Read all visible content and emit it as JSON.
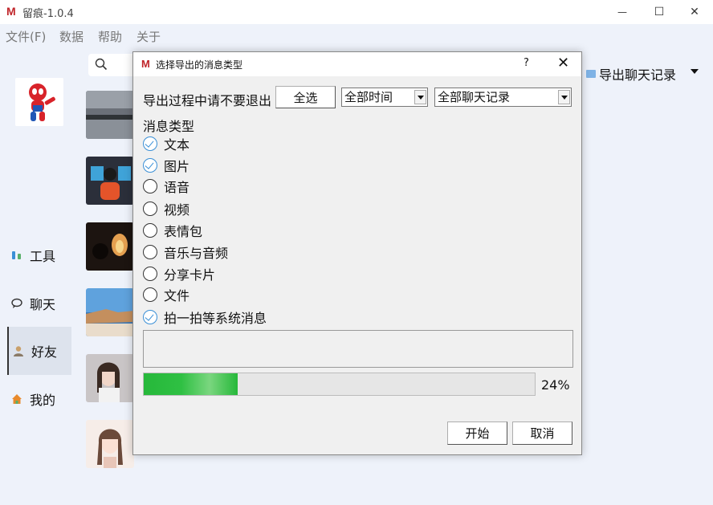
{
  "app": {
    "logo": "M",
    "title": "留痕-1.0.4"
  },
  "window_controls": {
    "minimize": "—",
    "maximize": "☐",
    "close": "✕"
  },
  "menu": [
    "文件(F)",
    "数据",
    "帮助",
    "关于"
  ],
  "sidebar": {
    "items": [
      {
        "label": "工具",
        "icon": "tools-icon"
      },
      {
        "label": "聊天",
        "icon": "chat-icon"
      },
      {
        "label": "好友",
        "icon": "user-icon",
        "active": true
      },
      {
        "label": "我的",
        "icon": "home-icon"
      }
    ]
  },
  "right_panel": {
    "export_label": "导出聊天记录"
  },
  "dialog": {
    "logo": "M",
    "title": "选择导出的消息类型",
    "help": "?",
    "close": "✕",
    "warning": "导出过程中请不要退出",
    "select_all": "全选",
    "time_select": "全部时间",
    "scope_select": "全部聊天记录",
    "section_label": "消息类型",
    "options": [
      {
        "label": "文本",
        "checked": true
      },
      {
        "label": "图片",
        "checked": true
      },
      {
        "label": "语音",
        "checked": false
      },
      {
        "label": "视频",
        "checked": false
      },
      {
        "label": "表情包",
        "checked": false
      },
      {
        "label": "音乐与音频",
        "checked": false
      },
      {
        "label": "分享卡片",
        "checked": false
      },
      {
        "label": "文件",
        "checked": false
      },
      {
        "label": "拍一拍等系统消息",
        "checked": true
      }
    ],
    "progress_value": 24,
    "progress_text": "24%",
    "start": "开始",
    "cancel": "取消"
  },
  "colors": {
    "accent": "#3a8fd6",
    "progress": "#26b83a",
    "brand": "#c0252a"
  }
}
